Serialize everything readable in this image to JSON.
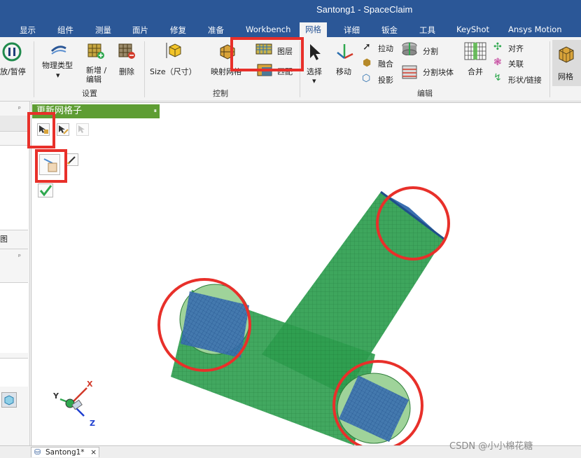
{
  "window": {
    "title": "Santong1 - SpaceClaim"
  },
  "menu": {
    "tabs": [
      {
        "label": "显示"
      },
      {
        "label": "组件"
      },
      {
        "label": "测量"
      },
      {
        "label": "面片"
      },
      {
        "label": "修复"
      },
      {
        "label": "准备"
      },
      {
        "label": "Workbench"
      },
      {
        "label": "网格"
      },
      {
        "label": "详细"
      },
      {
        "label": "钣金"
      },
      {
        "label": "工具"
      },
      {
        "label": "KeyShot"
      },
      {
        "label": "Ansys Motion"
      }
    ],
    "active": "网格"
  },
  "ribbon": {
    "play_pause": "放/暂停",
    "setup": {
      "label": "设置",
      "physics_type": "物理类型",
      "new_edit": "新增 / 编辑",
      "delete": "删除"
    },
    "control": {
      "label": "控制",
      "size": "Size（尺寸）",
      "mapped": "映射网格",
      "layers": "图层",
      "match": "匹配"
    },
    "edit": {
      "label": "编辑",
      "select": "选择",
      "move": "移动",
      "pull": "拉动",
      "blend": "融合",
      "project": "投影",
      "split": "分割",
      "split_block": "分割块体",
      "merge": "合并",
      "align": "对齐",
      "associate": "关联",
      "shape_link": "形状/链接"
    },
    "mesh": "网格"
  },
  "left_panel": {
    "text_fragment": "图",
    "pin_glyph": "ᵖ"
  },
  "tool_panel": {
    "title": "更新网格子",
    "pause_glyph": "⏸"
  },
  "document": {
    "tab": "Santong1*",
    "close": "×"
  },
  "triad": {
    "x": "X",
    "y": "Y",
    "z": "Z"
  },
  "watermark": "CSDN @小小棉花糖",
  "colors": {
    "titlebar": "#2b5797",
    "accent_green": "#5e9d33",
    "mesh_green": "#2e9e4f",
    "face_blue": "#3a6fb0",
    "highlight_red": "#e8302a"
  }
}
